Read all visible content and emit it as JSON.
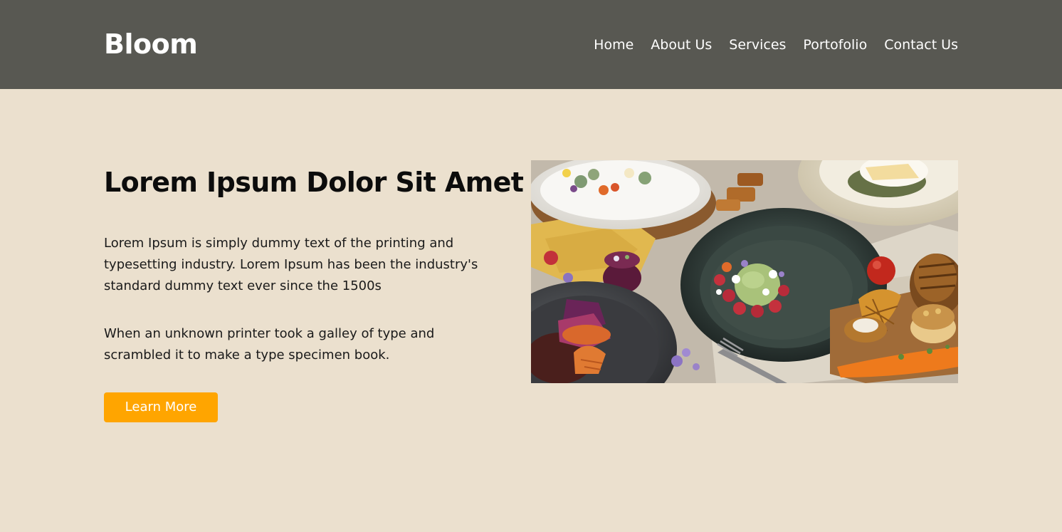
{
  "header": {
    "logo": "Bloom",
    "nav": [
      "Home",
      "About Us",
      "Services",
      "Portofolio",
      "Contact Us"
    ]
  },
  "hero": {
    "title": "Lorem Ipsum Dolor Sit Amet",
    "paragraph_1": "Lorem Ipsum is simply dummy text of the printing and typesetting industry. Lorem Ipsum has been the industry's standard dummy text ever since the 1500s",
    "paragraph_2": "When an unknown printer took a galley of type and scrambled it to make a type specimen book.",
    "button_label": "Learn More"
  },
  "colors": {
    "header_bg": "#585852",
    "page_bg": "#ebe0ce",
    "accent": "#ffa500"
  }
}
